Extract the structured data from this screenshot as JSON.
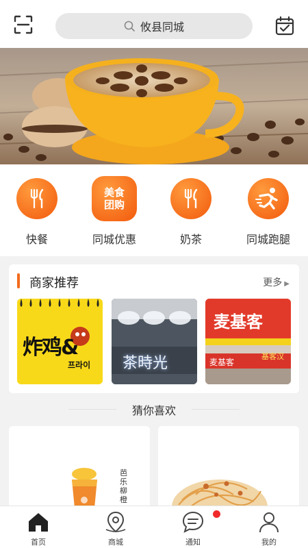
{
  "header": {
    "search_text": "攸县同城"
  },
  "categories": [
    {
      "label": "快餐",
      "icon": "fork-knife-icon"
    },
    {
      "label": "同城优惠",
      "icon": "food-group-buy-icon",
      "badge_lines": [
        "美食",
        "团购"
      ]
    },
    {
      "label": "奶茶",
      "icon": "fork-knife-icon"
    },
    {
      "label": "同城跑腿",
      "icon": "running-man-icon"
    }
  ],
  "merchants": {
    "title": "商家推荐",
    "more": "更多",
    "shops": [
      {
        "sign": "炸鸡&",
        "sub": "프라이"
      },
      {
        "sign": "茶時光"
      },
      {
        "sign": "麦基客",
        "sub": "麦基客",
        "tag": "基客汉"
      }
    ]
  },
  "recommend": {
    "title": "猜你喜欢",
    "items": [
      {
        "side_text": "芭乐柳橙"
      },
      {}
    ]
  },
  "tabbar": [
    {
      "label": "首页",
      "icon": "home-icon",
      "active": true
    },
    {
      "label": "商城",
      "icon": "map-pin-icon"
    },
    {
      "label": "通知",
      "icon": "chat-bubble-icon",
      "has_dot": true
    },
    {
      "label": "我的",
      "icon": "user-icon"
    }
  ],
  "colors": {
    "accent": "#f26b1d",
    "dot": "#f02a2a"
  }
}
